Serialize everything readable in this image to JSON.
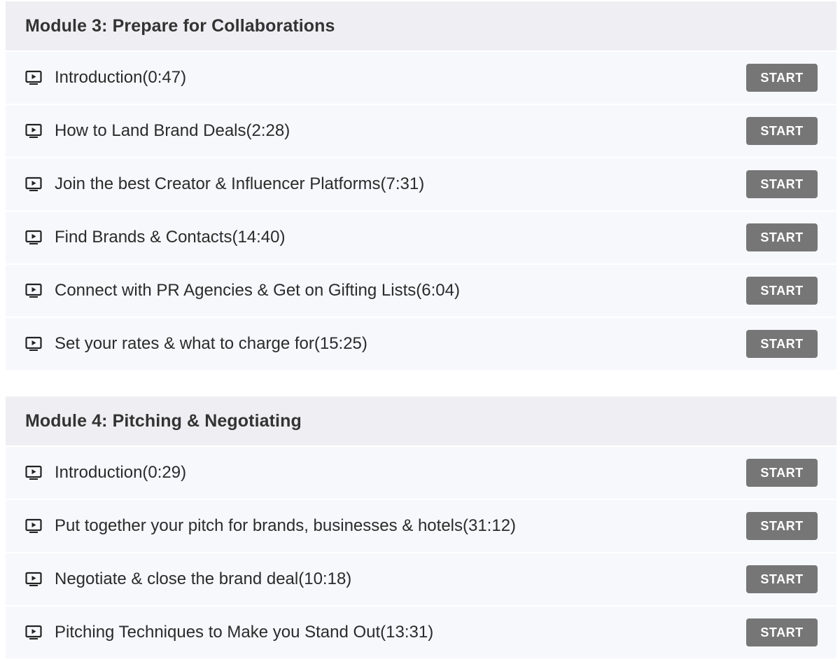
{
  "modules": [
    {
      "title": "Module 3: Prepare for Collaborations",
      "lessons": [
        {
          "title": "Introduction(0:47)",
          "button": "START"
        },
        {
          "title": "How to Land Brand Deals(2:28)",
          "button": "START"
        },
        {
          "title": "Join the best Creator & Influencer Platforms(7:31)",
          "button": "START"
        },
        {
          "title": "Find Brands & Contacts(14:40)",
          "button": "START"
        },
        {
          "title": "Connect with PR Agencies & Get on Gifting Lists(6:04)",
          "button": "START"
        },
        {
          "title": "Set your rates & what to charge for(15:25)",
          "button": "START"
        }
      ]
    },
    {
      "title": "Module 4: Pitching & Negotiating",
      "lessons": [
        {
          "title": "Introduction(0:29)",
          "button": "START"
        },
        {
          "title": "Put together your pitch for brands, businesses & hotels(31:12)",
          "button": "START"
        },
        {
          "title": "Negotiate & close the brand deal(10:18)",
          "button": "START"
        },
        {
          "title": "Pitching Techniques to Make you Stand Out(13:31)",
          "button": "START"
        }
      ]
    }
  ],
  "icons": {
    "lesson_icon": "video-play-icon"
  },
  "colors": {
    "header_bg": "#efeff3",
    "row_bg": "#f7f8fc",
    "button_bg": "#767676",
    "button_text": "#ffffff"
  }
}
